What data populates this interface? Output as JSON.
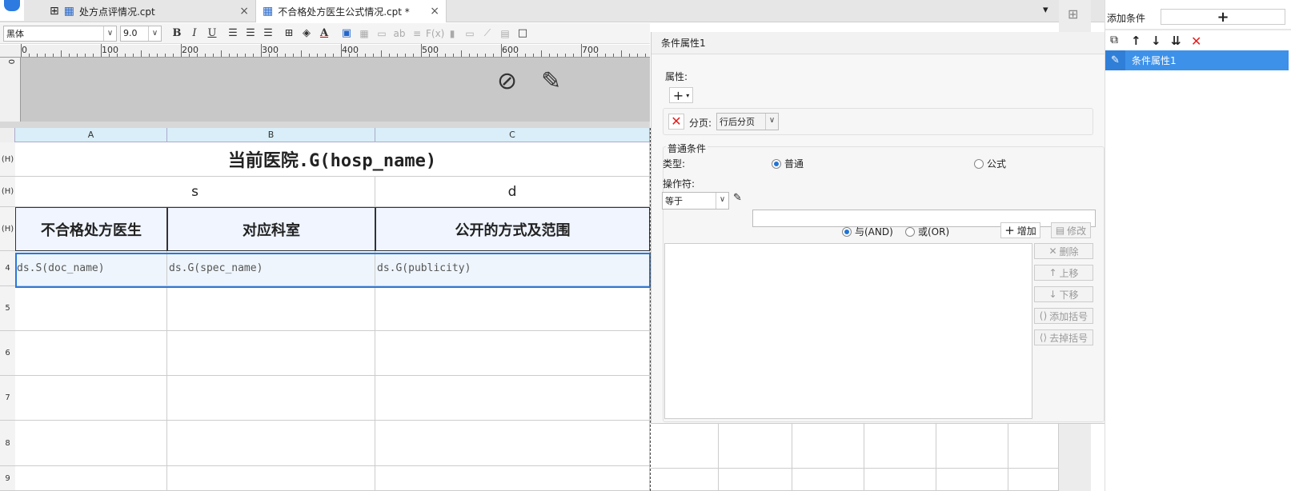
{
  "tabs": [
    {
      "label": "处方点评情况.cpt"
    },
    {
      "label": "不合格处方医生公式情况.cpt *"
    }
  ],
  "toolbar": {
    "font": "黑体",
    "size": "9.0",
    "bold": "B",
    "italic": "I",
    "underline": "U",
    "font_color": "A",
    "glyph_ab": "ab",
    "glyph_fx": "F(x)"
  },
  "ruler": [
    "0",
    "100",
    "200",
    "300",
    "400",
    "500",
    "600",
    "700"
  ],
  "vruler": "0",
  "columns": [
    "A",
    "B",
    "C"
  ],
  "rows": {
    "r1": "(H)",
    "r2": "(H)",
    "r3": "(H)",
    "r4": "4",
    "r5": "5",
    "r6": "6",
    "r7": "7",
    "r8": "8",
    "r9": "9"
  },
  "cells": {
    "title": "当前医院.G(hosp_name)",
    "sub_left": "s",
    "sub_right": "d",
    "hdr_a": "不合格处方医生",
    "hdr_b": "对应科室",
    "hdr_c": "公开的方式及范围",
    "dat_a": "ds.S(doc_name)",
    "dat_b": "ds.G(spec_name)",
    "dat_c": "ds.G(publicity)"
  },
  "dialog": {
    "title": "条件属性1",
    "attr_label": "属性:",
    "add_symbol": "+",
    "page_label": "分页:",
    "page_value": "行后分页",
    "normal_group": "普通条件",
    "type_label": "类型:",
    "type_normal": "普通",
    "type_formula": "公式",
    "op_label": "操作符:",
    "op_value": "等于",
    "op_input": "",
    "and_label": "与(AND)",
    "or_label": "或(OR)",
    "btn_add": "增加",
    "btn_edit": "修改",
    "btn_delete": "删除",
    "btn_up": "上移",
    "btn_down": "下移",
    "btn_add_paren": "添加括号",
    "btn_remove_paren": "去掉括号"
  },
  "right_panel": {
    "add_label": "添加条件",
    "add_symbol": "+",
    "item": "条件属性1"
  }
}
